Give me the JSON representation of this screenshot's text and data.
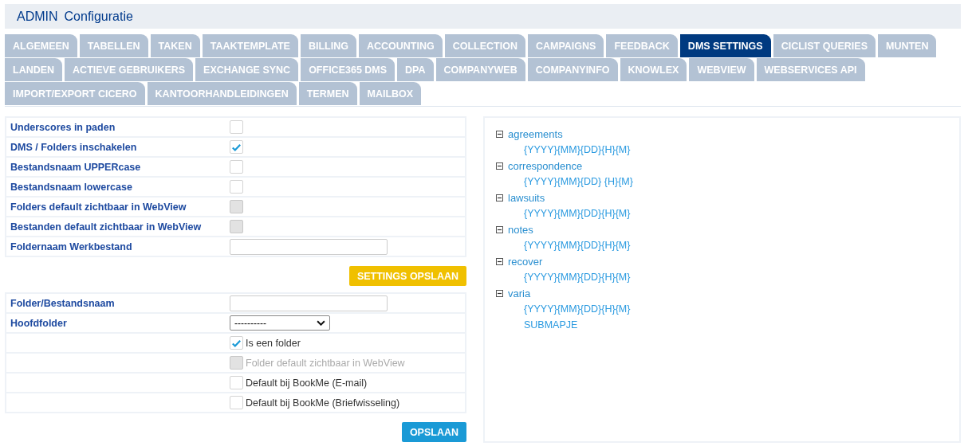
{
  "header": {
    "title_parts": [
      "ADMIN",
      "Configuratie"
    ]
  },
  "tab_rows": [
    [
      {
        "label": "ALGEMEEN",
        "selected": false
      },
      {
        "label": "TABELLEN",
        "selected": false
      },
      {
        "label": "TAKEN",
        "selected": false
      },
      {
        "label": "TAAKTEMPLATE",
        "selected": false
      },
      {
        "label": "BILLING",
        "selected": false
      },
      {
        "label": "ACCOUNTING",
        "selected": false
      },
      {
        "label": "COLLECTION",
        "selected": false
      },
      {
        "label": "CAMPAIGNS",
        "selected": false
      },
      {
        "label": "FEEDBACK",
        "selected": false
      },
      {
        "label": "DMS SETTINGS",
        "selected": true
      },
      {
        "label": "CICLIST QUERIES",
        "selected": false
      },
      {
        "label": "MUNTEN",
        "selected": false
      }
    ],
    [
      {
        "label": "LANDEN",
        "selected": false
      },
      {
        "label": "ACTIEVE GEBRUIKERS",
        "selected": false
      },
      {
        "label": "EXCHANGE SYNC",
        "selected": false
      },
      {
        "label": "OFFICE365 DMS",
        "selected": false
      },
      {
        "label": "DPA",
        "selected": false
      },
      {
        "label": "COMPANYWEB",
        "selected": false
      },
      {
        "label": "COMPANYINFO",
        "selected": false
      },
      {
        "label": "KNOWLEX",
        "selected": false
      },
      {
        "label": "WEBVIEW",
        "selected": false
      },
      {
        "label": "WEBSERVICES API",
        "selected": false
      }
    ],
    [
      {
        "label": "IMPORT/EXPORT CICERO",
        "selected": false
      },
      {
        "label": "KANTOORHANDLEIDINGEN",
        "selected": false
      },
      {
        "label": "TERMEN",
        "selected": false
      },
      {
        "label": "MAILBOX",
        "selected": false
      }
    ]
  ],
  "settings": [
    {
      "kind": "checkbox",
      "label": "Underscores in paden",
      "checked": false,
      "disabled": false
    },
    {
      "kind": "checkbox",
      "label": "DMS / Folders inschakelen",
      "checked": true,
      "disabled": false
    },
    {
      "kind": "checkbox",
      "label": "Bestandsnaam UPPERcase",
      "checked": false,
      "disabled": false
    },
    {
      "kind": "checkbox",
      "label": "Bestandsnaam lowercase",
      "checked": false,
      "disabled": false
    },
    {
      "kind": "checkbox",
      "label": "Folders default zichtbaar in WebView",
      "checked": false,
      "disabled": true
    },
    {
      "kind": "checkbox",
      "label": "Bestanden default zichtbaar in WebView",
      "checked": false,
      "disabled": true
    },
    {
      "kind": "text",
      "label": "Foldernaam Werkbestand"
    }
  ],
  "settings_button": "SETTINGS OPSLAAN",
  "folder_form": [
    {
      "kind": "text",
      "label": "Folder/Bestandsnaam"
    },
    {
      "kind": "select",
      "label": "Hoofdfolder",
      "value": "----------"
    },
    {
      "kind": "checkbox",
      "option": "Is een folder",
      "checked": true,
      "disabled": false
    },
    {
      "kind": "checkbox",
      "option": "Folder default zichtbaar in WebView",
      "checked": false,
      "disabled": true
    },
    {
      "kind": "checkbox",
      "option": "Default bij BookMe (E-mail)",
      "checked": false,
      "disabled": false
    },
    {
      "kind": "checkbox",
      "option": "Default bij BookMe (Briefwisseling)",
      "checked": false,
      "disabled": false
    }
  ],
  "save_button": "OPSLAAN",
  "tree": [
    {
      "label": "agreements",
      "expanded": true,
      "children": [
        {
          "label": "{YYYY}{MM}{DD}{H}{M}"
        }
      ]
    },
    {
      "label": "correspondence",
      "expanded": true,
      "children": [
        {
          "label": "{YYYY}{MM}{DD} {H}{M}"
        }
      ]
    },
    {
      "label": "lawsuits",
      "expanded": true,
      "children": [
        {
          "label": "{YYYY}{MM}{DD}{H}{M}"
        }
      ]
    },
    {
      "label": "notes",
      "expanded": true,
      "children": [
        {
          "label": "{YYYY}{MM}{DD}{H}{M}"
        }
      ]
    },
    {
      "label": "recover",
      "expanded": true,
      "children": [
        {
          "label": "{YYYY}{MM}{DD}{H}{M}"
        }
      ]
    },
    {
      "label": "varia",
      "expanded": true,
      "children": [
        {
          "label": "{YYYY}{MM}{DD}{H}{M}"
        },
        {
          "label": "SUBMAPJE"
        }
      ]
    }
  ]
}
